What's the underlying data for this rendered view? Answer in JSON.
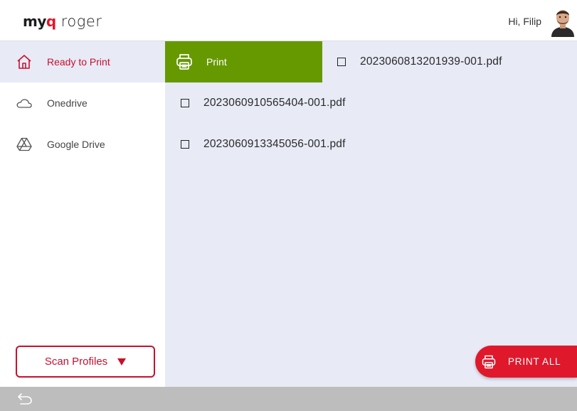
{
  "header": {
    "logo_myq_my": "my",
    "logo_myq_q": "q",
    "logo_roger": "roger",
    "greeting": "Hi, Filip",
    "avatar_icon": "user-avatar-photo"
  },
  "sidebar": {
    "items": [
      {
        "label": "Ready to Print",
        "icon": "home-icon",
        "active": true
      },
      {
        "label": "Onedrive",
        "icon": "cloud-icon",
        "active": false
      },
      {
        "label": "Google Drive",
        "icon": "google-drive-icon",
        "active": false
      }
    ],
    "scan_profiles_label": "Scan Profiles",
    "scan_profiles_icon": "caret-down-icon"
  },
  "main": {
    "print_tile_label": "Print",
    "print_tile_icon": "printer-icon",
    "files": [
      {
        "name": "2023060813201939-001.pdf",
        "checked": false
      },
      {
        "name": "2023060910565404-001.pdf",
        "checked": false
      },
      {
        "name": "2023060913345056-001.pdf",
        "checked": false
      }
    ],
    "print_all_label": "PRINT ALL",
    "print_all_icon": "printer-icon"
  },
  "bottombar": {
    "back_icon": "back-arrow-icon"
  },
  "colors": {
    "accent_red": "#c8102e",
    "print_all_red": "#e0182c",
    "print_green": "#669900",
    "content_bg": "#e8eaf6",
    "bottom_bar": "#bdbdbd"
  }
}
